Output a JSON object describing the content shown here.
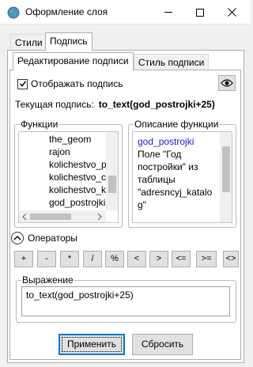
{
  "window": {
    "title": "Оформление слоя"
  },
  "tabs": [
    {
      "label": "Стили"
    },
    {
      "label": "Подпись",
      "active": true
    }
  ],
  "subtabs": [
    {
      "label": "Редактирование подписи",
      "active": true
    },
    {
      "label": "Стиль подписи"
    }
  ],
  "show_label": {
    "label": "Отображать подпись",
    "checked": true
  },
  "current_label": {
    "caption": "Текущая подпись:",
    "value": "to_text(god_postrojki+25)"
  },
  "functions": {
    "title": "Функции",
    "items": [
      "the_geom",
      "rajon",
      "kolichestvo_p",
      "kolichestvo_ce",
      "kolichestvo_kv",
      "god_postrojki"
    ]
  },
  "description": {
    "title": "Описание функции",
    "name": "god_postrojki",
    "lines": [
      "Поле \"Год",
      "постройки\" из",
      "таблицы",
      "\"adresncyj_katalo",
      "g\""
    ]
  },
  "operators": {
    "title": "Операторы",
    "buttons": [
      "+",
      "-",
      "*",
      "/",
      "%",
      "<",
      ">",
      "<=",
      ">=",
      "<>"
    ]
  },
  "expression": {
    "title": "Выражение",
    "value": "to_text(god_postrojki+25)"
  },
  "actions": {
    "apply": "Применить",
    "reset": "Сбросить"
  },
  "colors": {
    "accent": "#0078d7",
    "link": "#1a1ad6",
    "selection": "#cce8ff"
  }
}
